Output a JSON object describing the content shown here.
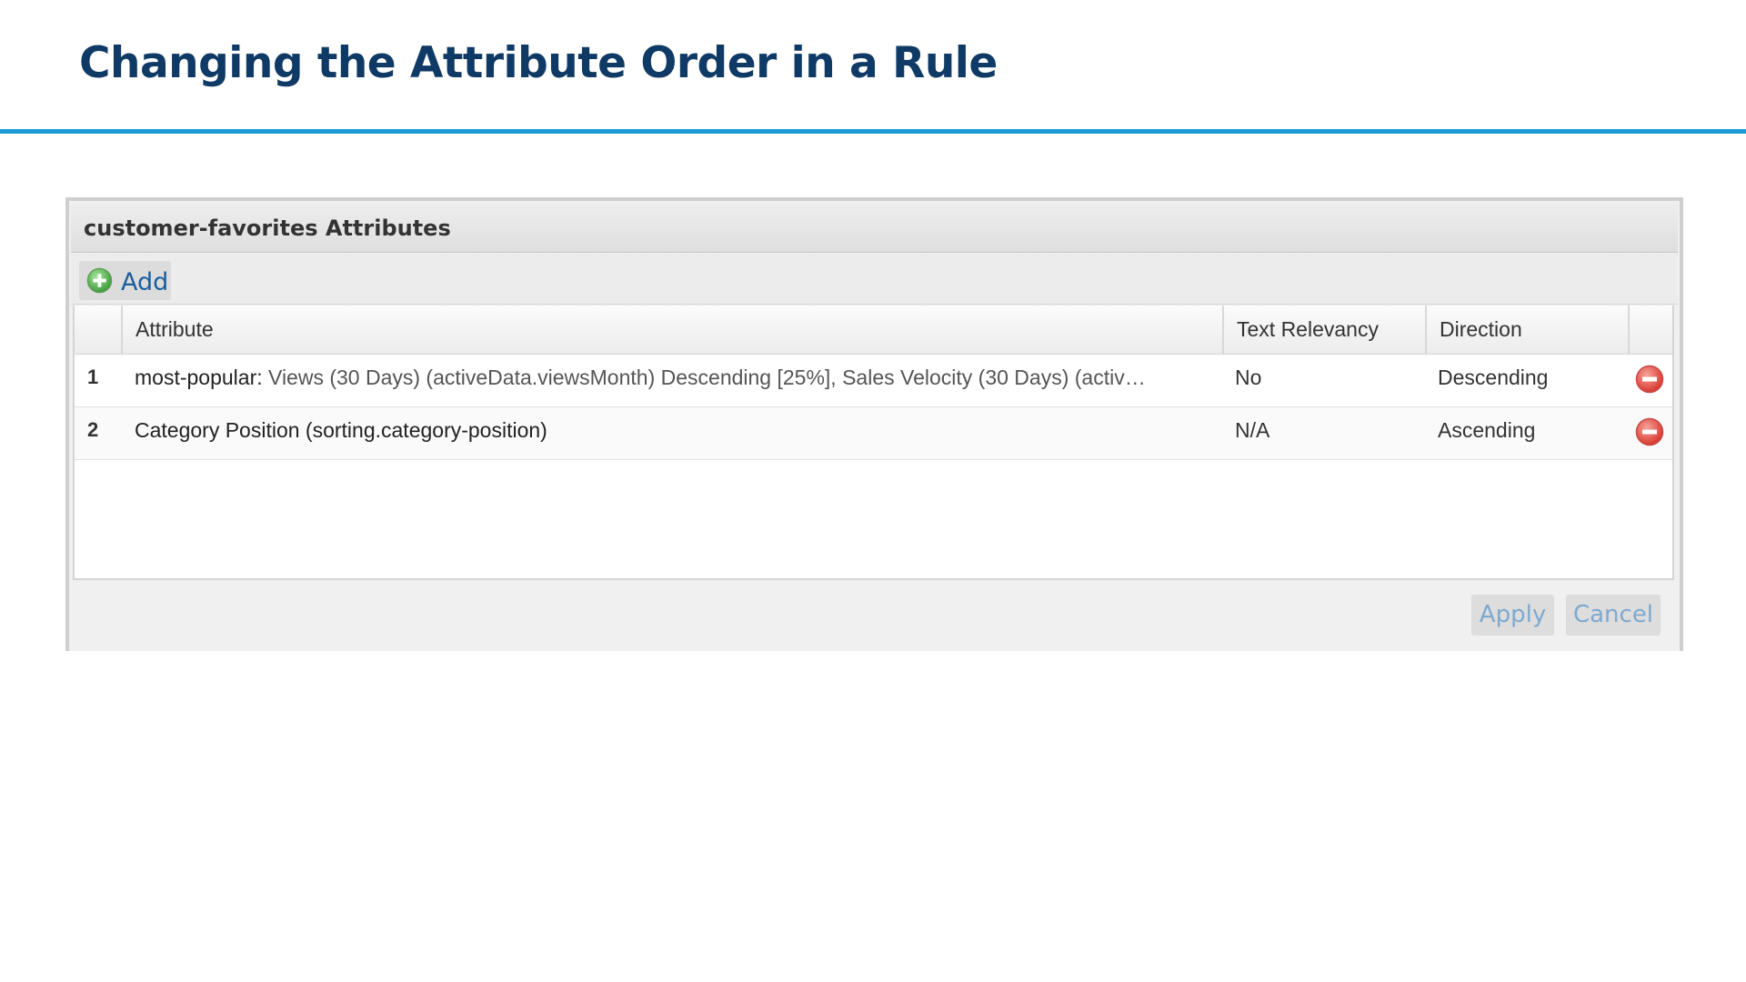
{
  "slide": {
    "title": "Changing the Attribute Order in a Rule"
  },
  "dialog": {
    "title": "customer-favorites Attributes",
    "toolbar": {
      "add_label": "Add",
      "add_icon": "plus-circle-icon"
    },
    "columns": {
      "attribute": "Attribute",
      "text_relevancy": "Text Relevancy",
      "direction": "Direction"
    },
    "rows": [
      {
        "index": "1",
        "attribute_name": "most-popular:",
        "attribute_detail": " Views (30 Days) (activeData.viewsMonth) Descending [25%], Sales Velocity (30 Days) (activ…",
        "text_relevancy": "No",
        "direction": "Descending",
        "remove_icon": "minus-circle-icon"
      },
      {
        "index": "2",
        "attribute_name": "Category Position (sorting.category-position)",
        "attribute_detail": "",
        "text_relevancy": "N/A",
        "direction": "Ascending",
        "remove_icon": "minus-circle-icon"
      }
    ],
    "footer": {
      "apply_label": "Apply",
      "cancel_label": "Cancel"
    }
  },
  "colors": {
    "title": "#0f3a66",
    "title_rule": "#1a9ad6",
    "link": "#1b5e9e",
    "remove": "#e0453f",
    "add": "#4caf50"
  }
}
